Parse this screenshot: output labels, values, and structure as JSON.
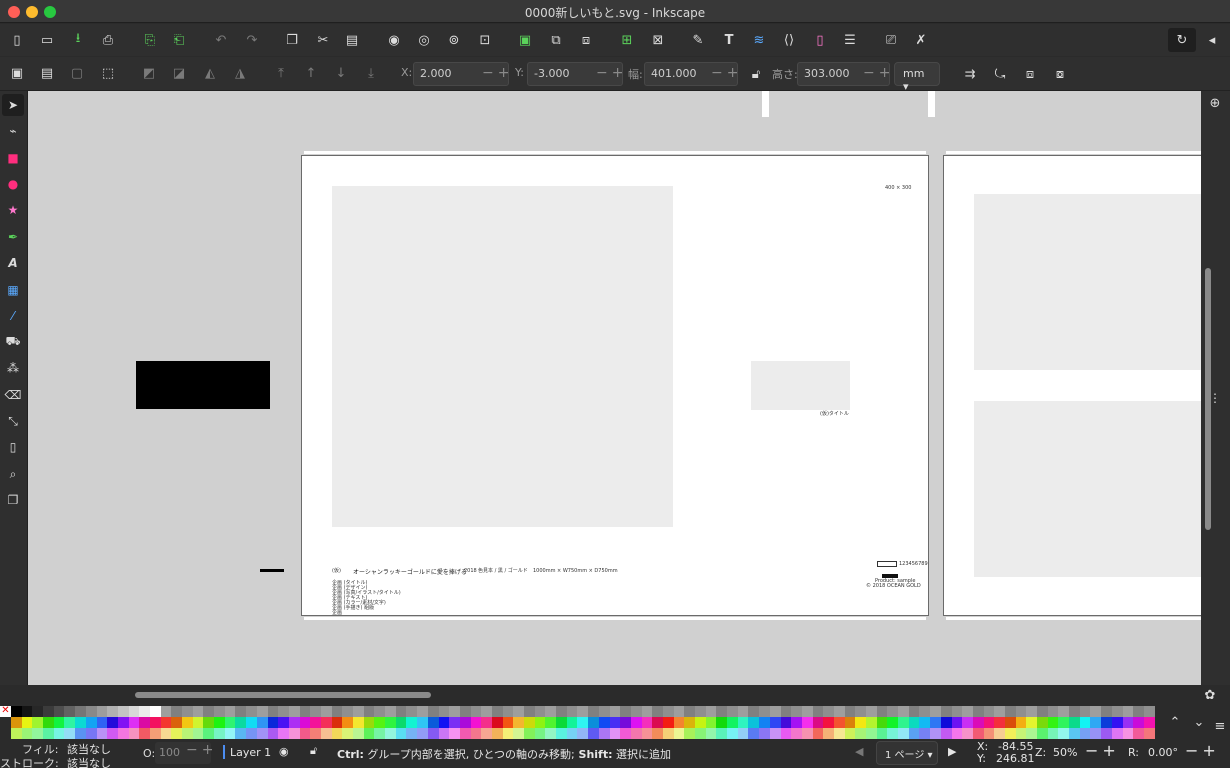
{
  "window": {
    "title": "0000新しいもと.svg - Inkscape"
  },
  "icons": {
    "new": "new-document-icon",
    "open": "open-icon",
    "save": "save-icon",
    "print": "print-icon",
    "import": "import-icon",
    "export": "export-icon",
    "undo": "undo-icon",
    "redo": "redo-icon",
    "copy": "copy-icon",
    "cut": "cut-icon",
    "paste": "paste-icon",
    "zoom_selection": "zoom-selection-icon",
    "zoom_drawing": "zoom-drawing-icon",
    "zoom_page": "zoom-page-icon",
    "zoom_fit": "zoom-fit-icon",
    "duplicate": "duplicate-icon",
    "clone": "clone-icon",
    "unlink": "unlink-clone-icon",
    "group": "group-icon",
    "ungroup": "ungroup-icon",
    "fill_stroke": "fill-stroke-icon",
    "text": "text-icon",
    "layers": "layers-icon",
    "xml": "xml-editor-icon",
    "objects": "objects-icon",
    "align": "align-icon",
    "doc_props": "document-properties-icon",
    "prefs": "preferences-icon",
    "snap": "snap-icon",
    "collapse": "collapse-icon"
  },
  "controls": {
    "x_label": "X:",
    "x_value": "2.000",
    "y_label": "Y:",
    "y_value": "-3.000",
    "w_label": "幅:",
    "w_value": "401.000",
    "h_label": "高さ:",
    "h_value": "303.000",
    "unit": "mm"
  },
  "doc": {
    "title_small": "(仮)",
    "title": "オーシャンラッキーゴールドに愛を捧げる",
    "meta1": "2018",
    "meta2": "色見本 / 黒 / ゴールド",
    "meta3": "1000mm × W750mm × D750mm",
    "pagenum": "400 × 300",
    "caption": "(仮)タイトル",
    "code": "123456789",
    "credit1": "Product: sample",
    "credit2": "© 2018 OCEAN GOLD",
    "notes": [
      "企画 (タイトル)",
      "企画 (デザイン)",
      "企画 (写真/イラスト/タイトル)",
      "企画 (テキスト)",
      "企画 (カラー/素材/文字)",
      "企画 (手描き) 組版",
      "企画"
    ]
  },
  "status": {
    "fill_label": "フィル:",
    "fill_value": "該当なし",
    "stroke_label": "ストローク:",
    "stroke_value": "該当なし",
    "opacity_label": "O:",
    "opacity_value": "100",
    "layer": "Layer 1",
    "message_ctrl": "Ctrl:",
    "message_ctrl_text": " グループ内部を選択, ひとつの軸のみ移動;",
    "message_shift": " Shift:",
    "message_shift_text": " 選択に追加",
    "page_select": "1 ページ",
    "x_label": "X:",
    "x_value": "-84.55",
    "y_label": "Y:",
    "y_value": "246.81",
    "zoom_label": "Z:",
    "zoom_value": "50%",
    "rotate_label": "R:",
    "rotate_value": "0.00°"
  },
  "colors": {
    "accent": "#4c8df0",
    "selected_page_border": "#6a6a6a"
  }
}
